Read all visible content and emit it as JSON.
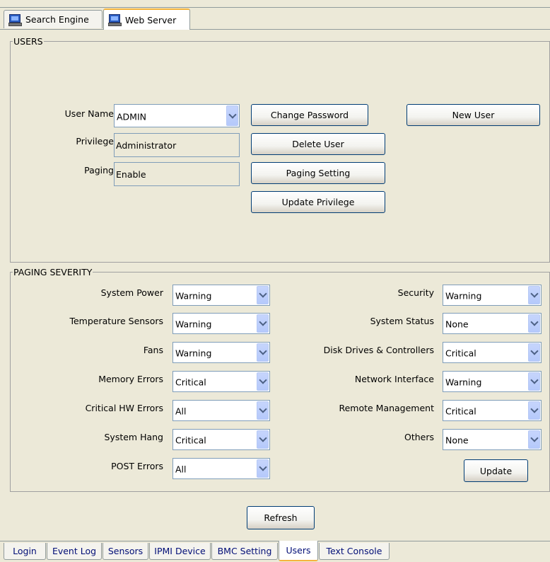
{
  "top_tabs": [
    {
      "label": "Search Engine",
      "icon": "computer-icon",
      "active": false
    },
    {
      "label": "Web Server",
      "icon": "computer-icon",
      "active": true
    }
  ],
  "users": {
    "legend": "USERS",
    "user_name_label": "User Name",
    "user_name_value": "ADMIN",
    "privilege_label": "Privilege",
    "privilege_value": "Administrator",
    "paging_label": "Paging",
    "paging_value": "Enable",
    "buttons": {
      "change_password": "Change Password",
      "delete_user": "Delete User",
      "paging_setting": "Paging Setting",
      "update_privilege": "Update Privilege",
      "new_user": "New User"
    }
  },
  "paging_severity": {
    "legend": "PAGING SEVERITY",
    "left": [
      {
        "label": "System Power",
        "value": "Warning"
      },
      {
        "label": "Temperature Sensors",
        "value": "Warning"
      },
      {
        "label": "Fans",
        "value": "Warning"
      },
      {
        "label": "Memory Errors",
        "value": "Critical"
      },
      {
        "label": "Critical HW Errors",
        "value": "All"
      },
      {
        "label": "System Hang",
        "value": "Critical"
      },
      {
        "label": "POST Errors",
        "value": "All"
      }
    ],
    "right": [
      {
        "label": "Security",
        "value": "Warning"
      },
      {
        "label": "System Status",
        "value": "None"
      },
      {
        "label": "Disk Drives & Controllers",
        "value": "Critical"
      },
      {
        "label": "Network Interface",
        "value": "Warning"
      },
      {
        "label": "Remote Management",
        "value": "Critical"
      },
      {
        "label": "Others",
        "value": "None"
      }
    ],
    "update_button": "Update"
  },
  "refresh_button": "Refresh",
  "bottom_tabs": [
    {
      "label": "Login",
      "active": false
    },
    {
      "label": "Event Log",
      "active": false
    },
    {
      "label": "Sensors",
      "active": false
    },
    {
      "label": "IPMI Device",
      "active": false
    },
    {
      "label": "BMC Setting",
      "active": false
    },
    {
      "label": "Users",
      "active": true
    },
    {
      "label": "Text Console",
      "active": false
    }
  ],
  "colors": {
    "panel_bg": "#ece9d8",
    "active_tab_accent": "#f5b43c",
    "button_border": "#003c74",
    "tab_text": "#000d76"
  }
}
